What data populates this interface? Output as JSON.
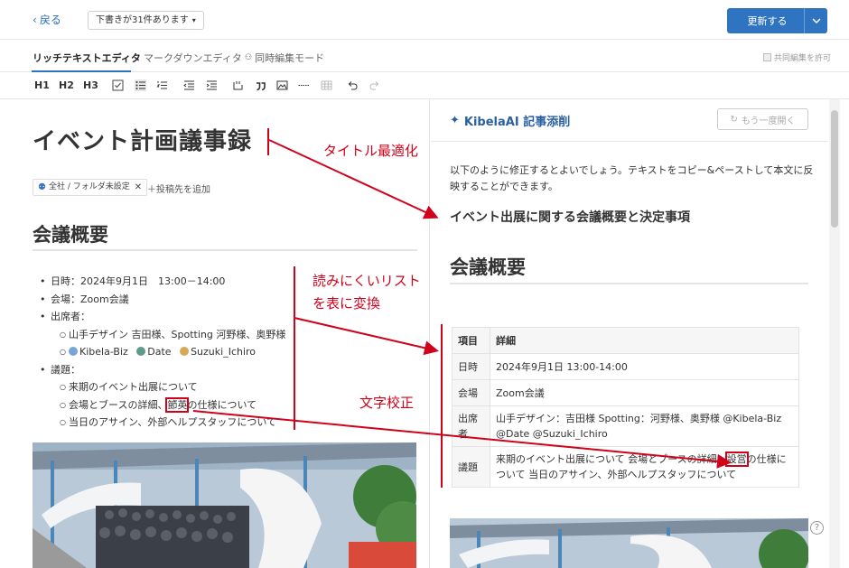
{
  "topbar": {
    "back_label": "戻る",
    "draft_label": "下書きが31件あります",
    "update_label": "更新する"
  },
  "tabs": {
    "rich": "リッチテキストエディタ",
    "markdown": "マークダウンエディタ",
    "collab_mode": "同時編集モード",
    "collab_permit": "共同編集を許可"
  },
  "toolbar": {
    "h1": "H1",
    "h2": "H2",
    "h3": "H3"
  },
  "editor": {
    "title": "イベント計画議事録",
    "tag_label": "全社 / フォルダ未設定",
    "add_target": "投稿先を追加",
    "section_heading": "会議概要",
    "list": {
      "date": "日時：2024年9月1日　13:00－14:00",
      "venue": "会場：Zoom会議",
      "attendees": "出席者：",
      "attendee_a": "山手デザイン 吉田様、Spotting 河野様、奥野様",
      "user_kibela": "Kibela-Biz",
      "user_date": "Date",
      "user_suzuki": "Suzuki_Ichiro",
      "agenda": "議題：",
      "agenda_1": "来期のイベント出展について",
      "agenda_2_pre": "会場とブースの詳細、",
      "agenda_2_err": "節英",
      "agenda_2_post": "の仕様について",
      "agenda_3": "当日のアサイン、外部ヘルプスタッフについて"
    }
  },
  "panel": {
    "title": "KibelaAI 記事添削",
    "reopen": "もう一度開く",
    "intro": "以下のように修正するとよいでしょう。テキストをコピー&ペーストして本文に反映することができます。",
    "suggested_title": "イベント出展に関する会議概要と決定事項",
    "section_heading": "会議概要",
    "table": {
      "h_item": "項目",
      "h_detail": "詳細",
      "r1_k": "日時",
      "r1_v": "2024年9月1日 13:00-14:00",
      "r2_k": "会場",
      "r2_v": "Zoom会議",
      "r3_k": "出席者",
      "r3_v": "山手デザイン：吉田様 Spotting：河野様、奥野様 @Kibela-Biz @Date @Suzuki_Ichiro",
      "r4_k": "議題",
      "r4_v_pre": "来期のイベント出展について 会場とブースの詳細、",
      "r4_v_fix": "設営",
      "r4_v_post": "の仕様について 当日のアサイン、外部ヘルプスタッフについて"
    }
  },
  "help": "?",
  "annotations": {
    "title_opt": "タイトル最適化",
    "list_to_table_1": "読みにくいリスト",
    "list_to_table_2": "を表に変換",
    "proofread": "文字校正"
  },
  "colors": {
    "accent": "#2f74c0",
    "annotation": "#d0021b"
  }
}
